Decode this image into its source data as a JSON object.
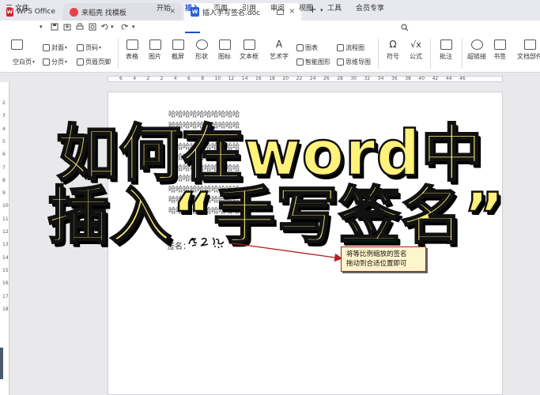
{
  "tabs": [
    {
      "label": "WPS Office",
      "icon": "wps-logo-icon"
    },
    {
      "label": "来稻壳 找模板",
      "icon": "template-logo-icon"
    },
    {
      "label": "插入手写签名.doc",
      "icon": "doc-logo-icon"
    }
  ],
  "menubar": {
    "file_label": "三 文件",
    "items": [
      "开始",
      "插入",
      "页面",
      "引用",
      "审阅",
      "视图",
      "工具",
      "会员专享"
    ],
    "active": "插入"
  },
  "ribbon": {
    "small_buttons": [
      "封面",
      "页码",
      "空白页",
      "分页",
      "页眉页脚"
    ],
    "big_buttons": [
      "表格",
      "图片",
      "截屏",
      "形状",
      "图标",
      "文本框",
      "艺术字",
      "符号",
      "公式",
      "批注",
      "超链接",
      "书签",
      "文档部件"
    ],
    "mid_buttons": [
      "图表",
      "流程图",
      "智能图形",
      "思维导图"
    ]
  },
  "ruler": {
    "h_numbers": [
      "6",
      "4",
      "2",
      "2",
      "4",
      "6",
      "8",
      "10",
      "12",
      "14",
      "16",
      "18",
      "20",
      "22",
      "24",
      "26",
      "28",
      "30",
      "32",
      "34",
      "36",
      "38",
      "40",
      "42",
      "44",
      "46"
    ],
    "v_numbers": [
      "2",
      "3",
      "4",
      "5",
      "6",
      "7",
      "8",
      "9",
      "10",
      "11",
      "12",
      "13",
      "14",
      "15",
      "16",
      "17",
      "18"
    ]
  },
  "document": {
    "repeated_lines": [
      "哈哈哈哈哈哈哈哈哈哈",
      "哈哈哈哈哈哈哈哈哈哈",
      "哈哈哈哈哈哈哈哈哈哈",
      "哈哈哈哈哈哈哈哈哈哈",
      "哈哈哈哈哈哈哈哈哈哈",
      "哈哈哈哈哈哈哈哈哈哈",
      "哈哈哈哈哈哈哈哈哈哈",
      "哈哈哈哈哈哈哈哈哈哈",
      "哈哈哈哈哈哈哈哈哈哈",
      "哈哈哈哈哈哈哈哈哈哈"
    ],
    "sign_label": "签名：",
    "signature_text": "唐 立 然"
  },
  "overlay": {
    "title_line1": "如何在word中",
    "title_line2": "插入“手写签名”"
  },
  "callout": {
    "line1": "将等比例缩放的签名",
    "line2": "拖动到合适位置即可"
  },
  "colors": {
    "accent": "#1d4ed8",
    "title_fill": "#fff27a",
    "callout_border": "#b22222",
    "callout_bg": "#fff5cc"
  }
}
